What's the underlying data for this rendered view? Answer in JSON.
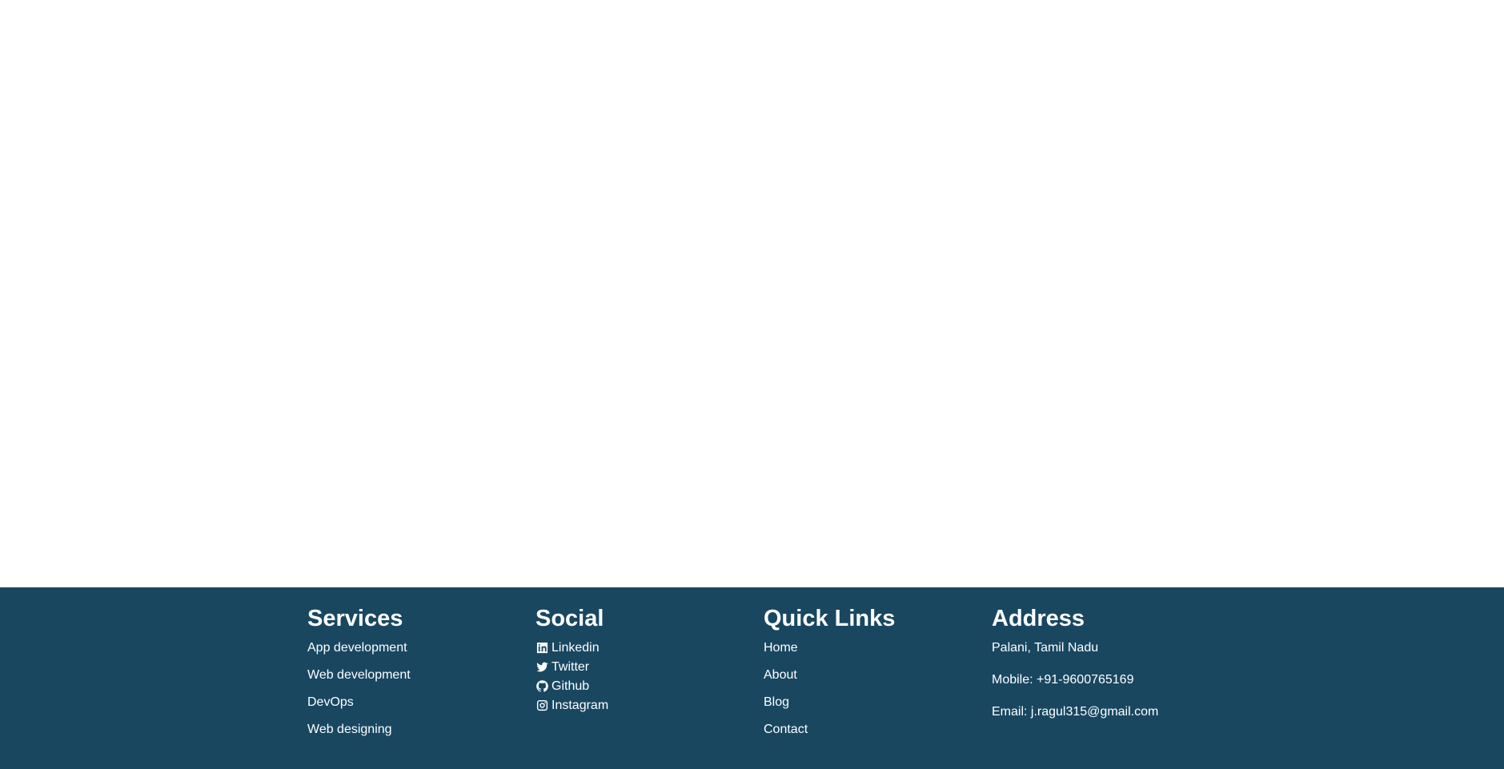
{
  "colors": {
    "footer_background": "#194760",
    "footer_text": "#ffffff",
    "page_background": "#ffffff"
  },
  "footer": {
    "services": {
      "title": "Services",
      "items": [
        {
          "label": "App development"
        },
        {
          "label": "Web development"
        },
        {
          "label": "DevOps"
        },
        {
          "label": "Web designing"
        }
      ]
    },
    "social": {
      "title": "Social",
      "items": [
        {
          "label": "Linkedin",
          "icon": "linkedin-icon"
        },
        {
          "label": "Twitter",
          "icon": "twitter-icon"
        },
        {
          "label": "Github",
          "icon": "github-icon"
        },
        {
          "label": "Instagram",
          "icon": "instagram-icon"
        }
      ]
    },
    "quick_links": {
      "title": "Quick Links",
      "items": [
        {
          "label": "Home"
        },
        {
          "label": "About"
        },
        {
          "label": "Blog"
        },
        {
          "label": "Contact"
        }
      ]
    },
    "address": {
      "title": "Address",
      "location": "Palani, Tamil Nadu",
      "mobile": "Mobile: +91-9600765169",
      "email": "Email: j.ragul315@gmail.com"
    }
  }
}
